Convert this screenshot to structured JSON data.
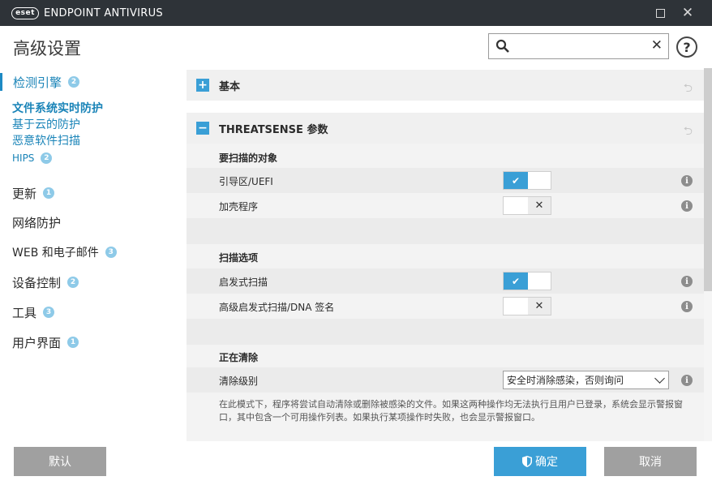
{
  "window": {
    "logo_text": "eset",
    "title": "ENDPOINT ANTIVIRUS",
    "maximize_icon": "maximize-icon",
    "close_icon": "close-icon"
  },
  "header": {
    "title": "高级设置",
    "search": {
      "value": "",
      "placeholder": ""
    },
    "help_label": "?"
  },
  "sidebar": {
    "items": [
      {
        "label": "检测引擎",
        "badge": "2"
      },
      {
        "label": "文件系统实时防护"
      },
      {
        "label": "基于云的防护"
      },
      {
        "label": "恶意软件扫描"
      },
      {
        "label": "HIPS",
        "badge": "2"
      },
      {
        "label": "更新",
        "badge": "1"
      },
      {
        "label": "网络防护"
      },
      {
        "label": "WEB 和电子邮件",
        "badge": "3"
      },
      {
        "label": "设备控制",
        "badge": "2"
      },
      {
        "label": "工具",
        "badge": "3"
      },
      {
        "label": "用户界面",
        "badge": "1"
      }
    ]
  },
  "main": {
    "sections": [
      {
        "title": "基本",
        "toggle": "+"
      },
      {
        "title": "THREATSENSE 参数",
        "toggle": "−"
      }
    ],
    "groups": {
      "scan_targets": {
        "title": "要扫描的对象",
        "rows": [
          {
            "label": "引导区/UEFI",
            "enabled": true
          },
          {
            "label": "加壳程序",
            "enabled": false
          }
        ]
      },
      "scan_options": {
        "title": "扫描选项",
        "rows": [
          {
            "label": "启发式扫描",
            "enabled": true
          },
          {
            "label": "高级启发式扫描/DNA 签名",
            "enabled": false
          }
        ]
      },
      "cleaning": {
        "title": "正在清除",
        "level_label": "清除级别",
        "level_value": "安全时消除感染，否则询问",
        "description": "在此模式下，程序将尝试自动清除或删除被感染的文件。如果这两种操作均无法执行且用户已登录，系统会显示警报窗口，其中包含一个可用操作列表。如果执行某项操作时失败，也会显示警报窗口。"
      }
    }
  },
  "footer": {
    "default_label": "默认",
    "ok_label": "确定",
    "cancel_label": "取消"
  },
  "colors": {
    "accent": "#3a9fd6",
    "titlebar": "#2e3338",
    "button_gray": "#a0a0a0",
    "badge": "#8ecae8"
  }
}
